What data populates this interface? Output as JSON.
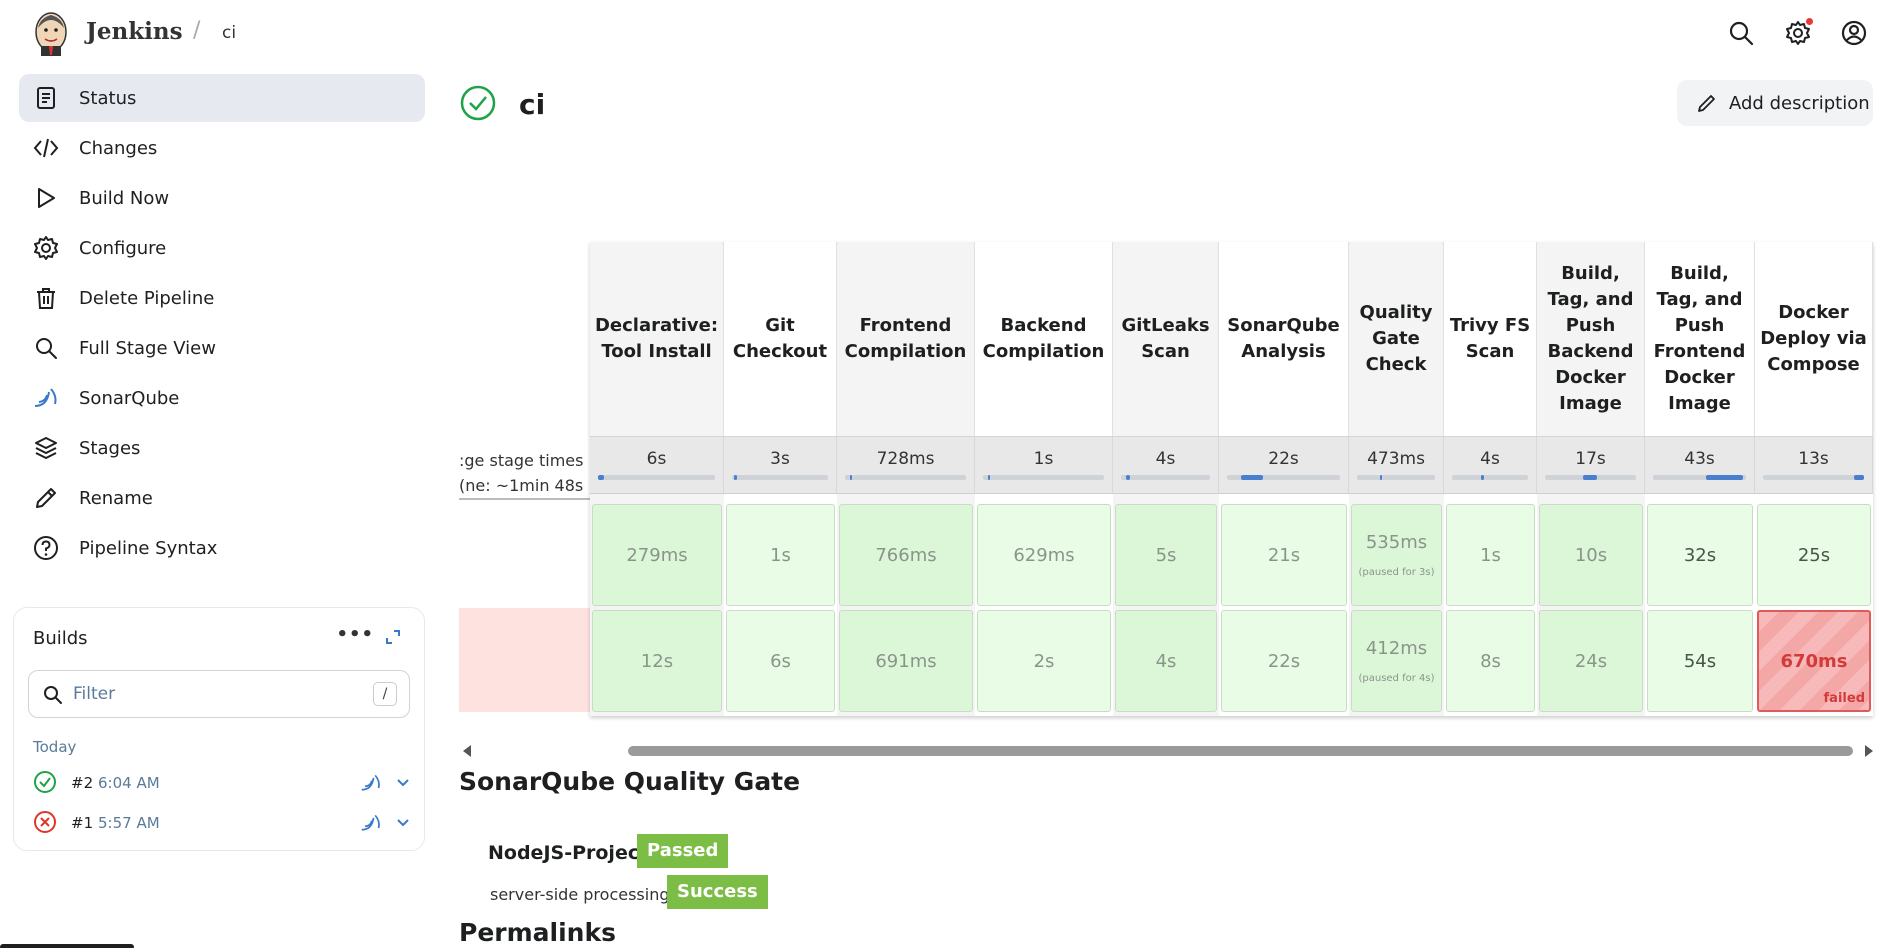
{
  "header": {
    "brand": "Jenkins",
    "separator": "/",
    "breadcrumb": "ci",
    "icons": [
      "search-icon",
      "settings-icon",
      "user-icon"
    ],
    "notification_color": "#e53935"
  },
  "sidebar": {
    "items": [
      {
        "label": "Status",
        "icon": "status-icon",
        "active": true
      },
      {
        "label": "Changes",
        "icon": "code-icon"
      },
      {
        "label": "Build Now",
        "icon": "play-icon"
      },
      {
        "label": "Configure",
        "icon": "gear-icon"
      },
      {
        "label": "Delete Pipeline",
        "icon": "trash-icon"
      },
      {
        "label": "Full Stage View",
        "icon": "search-icon"
      },
      {
        "label": "SonarQube",
        "icon": "sonarqube-icon"
      },
      {
        "label": "Stages",
        "icon": "layers-icon"
      },
      {
        "label": "Rename",
        "icon": "pencil-icon"
      },
      {
        "label": "Pipeline Syntax",
        "icon": "help-icon"
      }
    ]
  },
  "builds": {
    "title": "Builds",
    "more": "•••",
    "filter_placeholder": "Filter",
    "filter_shortcut": "/",
    "group": "Today",
    "items": [
      {
        "number": "#2",
        "time": "6:04 AM",
        "status": "success"
      },
      {
        "number": "#1",
        "time": "5:57 AM",
        "status": "failed"
      }
    ]
  },
  "main": {
    "title": "ci",
    "add_description": "Add description",
    "avg_label_line1": "ge stage times:",
    "avg_label_line2": "ne: ~1min 48s)"
  },
  "stages": [
    {
      "name": "Declarative: Tool Install",
      "avg": "6s",
      "bar": [
        0.0,
        0.05
      ],
      "r1": "279ms",
      "r2": "12s",
      "shade": "dark"
    },
    {
      "name": "Git Checkout",
      "avg": "3s",
      "bar": [
        0.02,
        0.03
      ],
      "r1": "1s",
      "r2": "6s",
      "shade": "light"
    },
    {
      "name": "Frontend Compilation",
      "avg": "728ms",
      "bar": [
        0.04,
        0.02
      ],
      "r1": "766ms",
      "r2": "691ms",
      "shade": "dark"
    },
    {
      "name": "Backend Compilation",
      "avg": "1s",
      "bar": [
        0.04,
        0.02
      ],
      "r1": "629ms",
      "r2": "2s",
      "shade": "light"
    },
    {
      "name": "GitLeaks Scan",
      "avg": "4s",
      "bar": [
        0.06,
        0.04
      ],
      "r1": "5s",
      "r2": "4s",
      "shade": "dark"
    },
    {
      "name": "SonarQube Analysis",
      "avg": "22s",
      "bar": [
        0.12,
        0.2
      ],
      "r1": "21s",
      "r2": "22s",
      "shade": "light"
    },
    {
      "name": "Quality Gate Check",
      "avg": "473ms",
      "bar": [
        0.3,
        0.02
      ],
      "r1": "535ms",
      "r1_note": "(paused for 3s)",
      "r2": "412ms",
      "r2_note": "(paused for 4s)",
      "shade": "dark"
    },
    {
      "name": "Trivy FS Scan",
      "avg": "4s",
      "bar": [
        0.38,
        0.04
      ],
      "r1": "1s",
      "r2": "8s",
      "shade": "light"
    },
    {
      "name": "Build, Tag, and Push Backend Docker Image",
      "avg": "17s",
      "bar": [
        0.42,
        0.15
      ],
      "r1": "10s",
      "r2": "24s",
      "shade": "dark"
    },
    {
      "name": "Build, Tag, and Push Frontend Docker Image",
      "avg": "43s",
      "bar": [
        0.57,
        0.4
      ],
      "r1": "32s",
      "r2": "54s",
      "shade": "light",
      "strong": true
    },
    {
      "name": "Docker Deploy via Compose",
      "avg": "13s",
      "bar": [
        0.9,
        0.1
      ],
      "r1": "25s",
      "r2": "670ms",
      "r2_status": "failed",
      "shade": "light",
      "strong": true
    }
  ],
  "sonar": {
    "title": "SonarQube Quality Gate",
    "project": "NodeJS-Project",
    "status": "Passed",
    "processing_label": "server-side processing:",
    "processing_status": "Success",
    "badge_color": "#7cbd46"
  },
  "permalinks": {
    "title": "Permalinks"
  }
}
